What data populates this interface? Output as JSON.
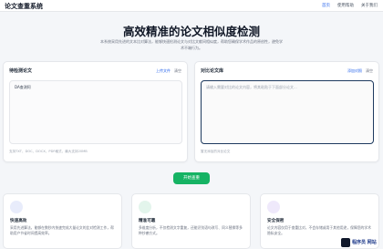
{
  "header": {
    "brand": "论文查重系统",
    "nav": [
      "首页",
      "使用帮助",
      "关于我们"
    ]
  },
  "hero": {
    "title": "高效精准的论文相似度检测",
    "subtitle": "本系统采用先进的文本比对算法，能够快速检测论文与对比文献间相似度，帮助您确保学术作品的原创性，避免学术不端行为。"
  },
  "left_panel": {
    "title": "待检测论文",
    "upload_label": "上传文件",
    "clear_label": "清空",
    "content": "DA查测阿",
    "hint": "支持TXT、DOC、DOCX、PDF格式，最大支持20MB"
  },
  "right_panel": {
    "title": "对比论文库",
    "add_label": "添加对照",
    "clear_label": "清空",
    "placeholder": "请输入需要对比的论文内容，将其粘贴于下面部分论文...",
    "hint": "暂无添加的对比论文"
  },
  "action": {
    "start_label": "开始查重"
  },
  "features": [
    {
      "title": "快速高效",
      "desc": "采用先进算法，能够在数秒内快速完成大量论文的比对检测工作，帮助用户节省时间提高效率。",
      "icon": "lightning-icon"
    },
    {
      "title": "精准可靠",
      "desc": "多维度分析，不仅检测文字重复，还能识别语句改写、同义替换等多种抄袭方式。",
      "icon": "target-icon"
    },
    {
      "title": "安全保密",
      "desc": "论文内容仅用于查重比对，不会存储或用于其他用途，保障您的学术隐私安全。",
      "icon": "lock-icon"
    }
  ],
  "watermark": {
    "text": "程序员 网站"
  },
  "colors": {
    "accent": "#2563eb",
    "start_button": "#16b364",
    "icon_bg_1": "#e8ecfb",
    "icon_bg_2": "#e3f5ec",
    "icon_bg_3": "#efe9fb"
  }
}
